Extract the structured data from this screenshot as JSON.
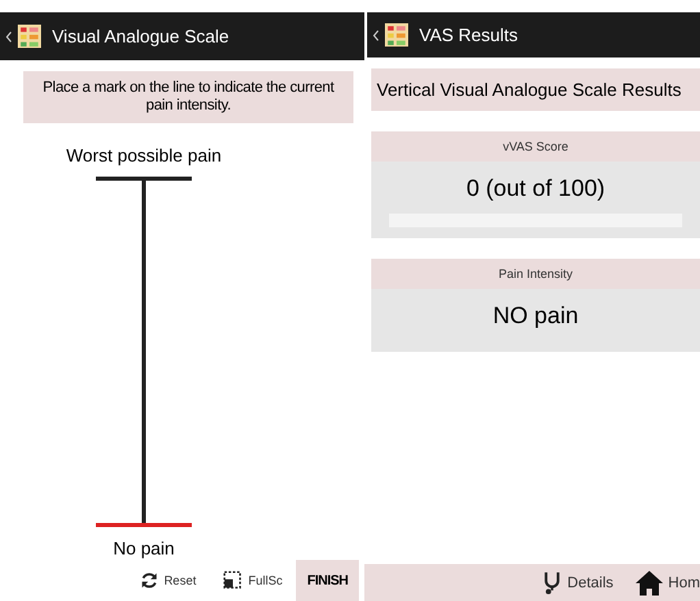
{
  "left_screen": {
    "title": "Visual Analogue Scale",
    "instruction": "Place a mark on the line to indicate the current pain intensity.",
    "scale": {
      "top_label": "Worst possible pain",
      "bottom_label": "No pain"
    },
    "toolbar": [
      {
        "kind": "reset",
        "label": "Reset"
      },
      {
        "kind": "fullscreen",
        "label": "FullSc"
      },
      {
        "kind": "finish",
        "label": "FINISH"
      }
    ]
  },
  "right_screen": {
    "title": "VAS Results",
    "heading": "Vertical Visual Analogue Scale Results",
    "cards": [
      {
        "label": "vVAS Score",
        "value": "0 (out of 100)",
        "level": 0
      },
      {
        "label": "Pain Intensity",
        "value": "NO pain"
      }
    ],
    "toolbar": [
      {
        "kind": "details",
        "label": "Details"
      },
      {
        "kind": "home",
        "label": "Hom"
      }
    ]
  }
}
